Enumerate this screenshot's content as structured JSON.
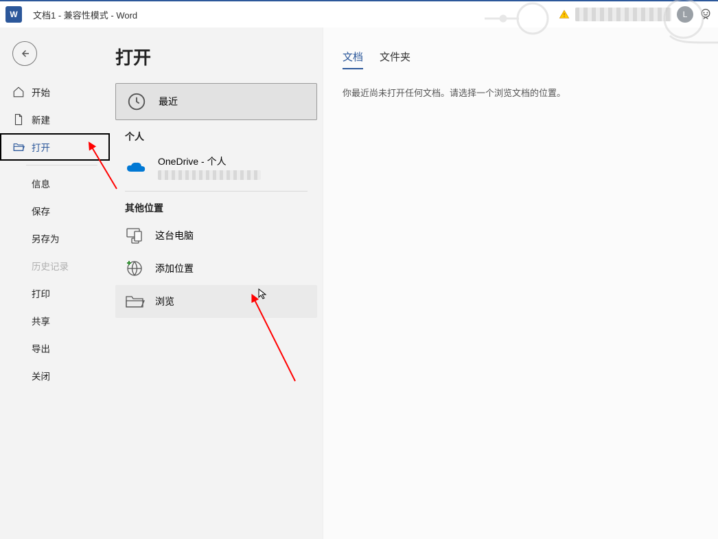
{
  "title": "文档1  -  兼容性模式  -  Word",
  "user_initial": "L",
  "nav": {
    "home": "开始",
    "new": "新建",
    "open": "打开",
    "info": "信息",
    "save": "保存",
    "saveas": "另存为",
    "history": "历史记录",
    "print": "打印",
    "share": "共享",
    "export": "导出",
    "close": "关闭"
  },
  "page_title": "打开",
  "locations": {
    "recent": "最近",
    "personal_section": "个人",
    "onedrive": "OneDrive - 个人",
    "other_section": "其他位置",
    "this_pc": "这台电脑",
    "add_place": "添加位置",
    "browse": "浏览"
  },
  "tabs": {
    "documents": "文档",
    "folders": "文件夹"
  },
  "hint": "你最近尚未打开任何文档。请选择一个浏览文档的位置。"
}
